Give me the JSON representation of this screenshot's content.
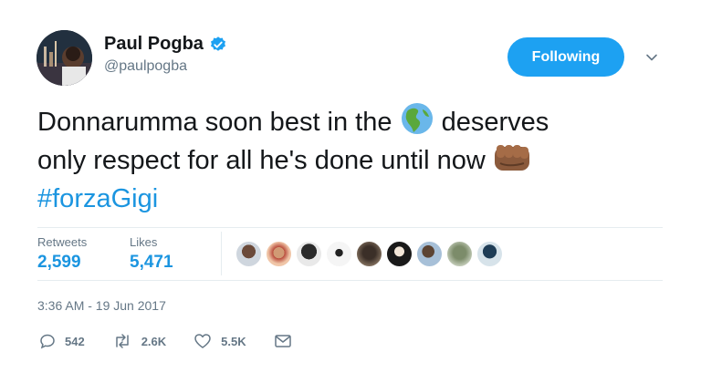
{
  "author": {
    "name": "Paul Pogba",
    "handle": "@paulpogba",
    "verified_icon": "verified-badge-icon"
  },
  "follow_button": {
    "label": "Following"
  },
  "tweet": {
    "text_line1_a": "Donnarumma soon best in the ",
    "text_line1_b": " deserves",
    "text_line2": "only respect for all he's done until now ",
    "hashtag": "#forzaGigi",
    "emojis": [
      "globe-americas-emoji",
      "oncoming-fist-emoji"
    ]
  },
  "stats": {
    "retweets_label": "Retweets",
    "retweets_value": "2,599",
    "likes_label": "Likes",
    "likes_value": "5,471"
  },
  "likers_count": 9,
  "timestamp": "3:36 AM - 19 Jun 2017",
  "actions": {
    "reply_count": "542",
    "retweet_count": "2.6K",
    "like_count": "5.5K"
  },
  "colors": {
    "accent": "#1da1f2",
    "link": "#1b95e0",
    "muted": "#657786",
    "text": "#14171a"
  }
}
